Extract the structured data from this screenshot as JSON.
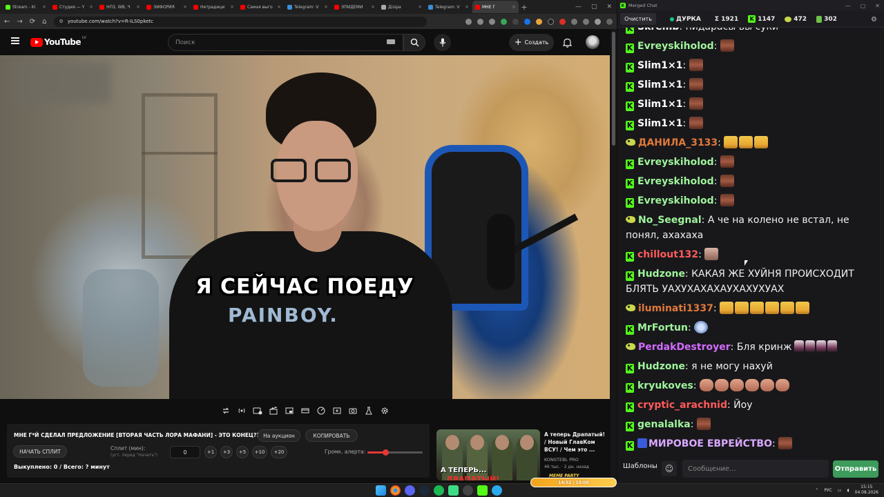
{
  "browser": {
    "tabs": [
      {
        "title": "Stream - Ki",
        "color": "#53fc18"
      },
      {
        "title": "Студия — Y",
        "color": "#ff0000"
      },
      {
        "title": "НПЗ, WB, Ч",
        "color": "#ff0000"
      },
      {
        "title": "ЭЙФОРИЯ",
        "color": "#ff0000"
      },
      {
        "title": "Нетрадици",
        "color": "#ff0000"
      },
      {
        "title": "Самая выго",
        "color": "#ff0000"
      },
      {
        "title": "Telegram: V",
        "color": "#3a8fd8"
      },
      {
        "title": "ЭПИДЕМИ",
        "color": "#ff0000"
      },
      {
        "title": "Дiзiра",
        "color": "#aaaaaa"
      },
      {
        "title": "Telegram: V",
        "color": "#3a8fd8"
      },
      {
        "title": "МНЕ Г",
        "color": "#ff0000",
        "active": true
      }
    ],
    "new_tab": "+",
    "url": "youtube.com/watch?v=R-ILS0pketc"
  },
  "youtube": {
    "logo_text": "YouTube",
    "country_code": "LV",
    "search_placeholder": "Поиск",
    "create_label": "Создать",
    "subtitle": "Я СЕЙЧАС ПОЕДУ",
    "shirt_print": "PAINBOY."
  },
  "panel": {
    "title": "МНЕ Г*Й СДЕЛАЛ ПРЕДЛОЖЕНИЕ [ВТОРАЯ ЧАСТЬ ЛОРА МАФАНИ] - ЭТО КОНЕЦ???",
    "auction_button": "На аукцион",
    "copy_button": "КОПИРОВАТЬ",
    "start_split_button": "НАЧАТЬ СПЛИТ",
    "split_label": "Сплит (мин):",
    "split_hint": "(уст. перед \"Начать\")",
    "split_value": "0",
    "increments": [
      "+1",
      "+3",
      "+5",
      "+10",
      "+20"
    ],
    "alert_volume_label": "Громк. алерта:",
    "alert_volume": 0.33,
    "bought_text": "Выкуплено: 0 / Всего: ? минут"
  },
  "recommended": {
    "title": "А теперь Драпатый! / Новый ГлавКом ВСУ! / Чем это ...",
    "channel": "KONSTEBL PRO",
    "meta": "46 тыс. · 2 дн. назад",
    "thumb_text1": "А ТЕПЕРЬ...",
    "thumb_text2": "ДРАПАТЫЙ!"
  },
  "chat": {
    "window_title": "Merged Chat",
    "clear_button": "Очистить",
    "stream_name": "ДУРКА",
    "total_label": "Σ 1921",
    "kick_count": "1147",
    "twitch_count": "472",
    "other_count": "302",
    "messages": [
      {
        "platform": "kick",
        "nick": "Skremb",
        "color": "#ffffff",
        "text": "пидарасы вы суки",
        "emotes": [],
        "line": 1
      },
      {
        "platform": "kick",
        "nick": "Evreyskiholod",
        "color": "#9ff59b",
        "text": "",
        "emotes": [
          "face"
        ],
        "line": 1
      },
      {
        "platform": "kick",
        "nick": "Slim1×1",
        "color": "#ffffff",
        "text": "",
        "emotes": [
          "face"
        ],
        "line": 1
      },
      {
        "platform": "kick",
        "nick": "Slim1×1",
        "color": "#ffffff",
        "text": "",
        "emotes": [
          "face"
        ],
        "line": 1
      },
      {
        "platform": "kick",
        "nick": "Slim1×1",
        "color": "#ffffff",
        "text": "",
        "emotes": [
          "face"
        ],
        "line": 1
      },
      {
        "platform": "kick",
        "nick": "Slim1×1",
        "color": "#ffffff",
        "text": "",
        "emotes": [
          "face"
        ],
        "line": 1
      },
      {
        "platform": "twitch",
        "nick": "ДАНИЛА_3133",
        "color": "#e0793a",
        "text": "",
        "emotes": [
          "lol",
          "lol",
          "lol"
        ],
        "line": 1
      },
      {
        "platform": "kick",
        "nick": "Evreyskiholod",
        "color": "#9ff59b",
        "text": "",
        "emotes": [
          "face"
        ],
        "line": 1
      },
      {
        "platform": "kick",
        "nick": "Evreyskiholod",
        "color": "#9ff59b",
        "text": "",
        "emotes": [
          "face"
        ],
        "line": 1
      },
      {
        "platform": "kick",
        "nick": "Evreyskiholod",
        "color": "#9ff59b",
        "text": "",
        "emotes": [
          "face"
        ],
        "line": 1
      },
      {
        "platform": "twitch",
        "nick": "No_Seegnal",
        "color": "#9ff59b",
        "text": "А че на колено не встал, не понял, ахахаха",
        "emotes": [],
        "line": 2
      },
      {
        "platform": "kick",
        "nick": "chillout132",
        "color": "#ff5a5a",
        "text": "",
        "emotes": [
          "cat"
        ],
        "line": 1
      },
      {
        "platform": "kick",
        "nick": "Hudzone",
        "color": "#9ff59b",
        "text": "КАКАЯ ЖЕ ХУЙНЯ ПРОИСХОДИТ БЛЯТЬ УАХУХАХАХАУХАХУХУАХ",
        "emotes": [],
        "line": 2
      },
      {
        "platform": "twitch",
        "nick": "iluminati1337",
        "color": "#e0793a",
        "text": "",
        "emotes": [
          "lol",
          "lol",
          "lol",
          "lol",
          "lol",
          "lol"
        ],
        "line": 1
      },
      {
        "platform": "kick",
        "nick": "MrFortun",
        "color": "#9ff59b",
        "text": "",
        "emotes": [
          "blue"
        ],
        "line": 1
      },
      {
        "platform": "twitch",
        "nick": "PerdakDestroyer",
        "color": "#d36bff",
        "text": "Бля кринж",
        "emotes": [
          "fig",
          "fig",
          "fig",
          "fig"
        ],
        "line": 1
      },
      {
        "platform": "kick",
        "nick": "Hudzone",
        "color": "#9ff59b",
        "text": "я не могу нахуй",
        "emotes": [],
        "line": 1
      },
      {
        "platform": "kick",
        "nick": "kryukoves",
        "color": "#9ff59b",
        "text": "",
        "emotes": [
          "hand",
          "hand",
          "hand",
          "hand",
          "hand",
          "hand"
        ],
        "line": 1
      },
      {
        "platform": "kick",
        "nick": "cryptic_arachnid",
        "color": "#ff5a5a",
        "text": "Йоу",
        "emotes": [],
        "line": 1
      },
      {
        "platform": "kick",
        "nick": "genalalka",
        "color": "#9ff59b",
        "text": "",
        "emotes": [
          "face"
        ],
        "line": 1
      },
      {
        "platform": "kick",
        "nick": "МИРОВОЕ ЕВРЕЙСТВО",
        "color": "#d9a8ff",
        "text": "",
        "emotes": [
          "face"
        ],
        "line": 1,
        "badge": true
      }
    ],
    "templates_button": "Шаблоны",
    "message_placeholder": "Сообщение...",
    "send_button": "Отправить"
  },
  "taskbar": {
    "meme_party": "MEME PARTY",
    "meme_bar_text": "14:52 / 15:00",
    "lang": "РУС",
    "time": "15:15",
    "date": "04.08.2026"
  }
}
